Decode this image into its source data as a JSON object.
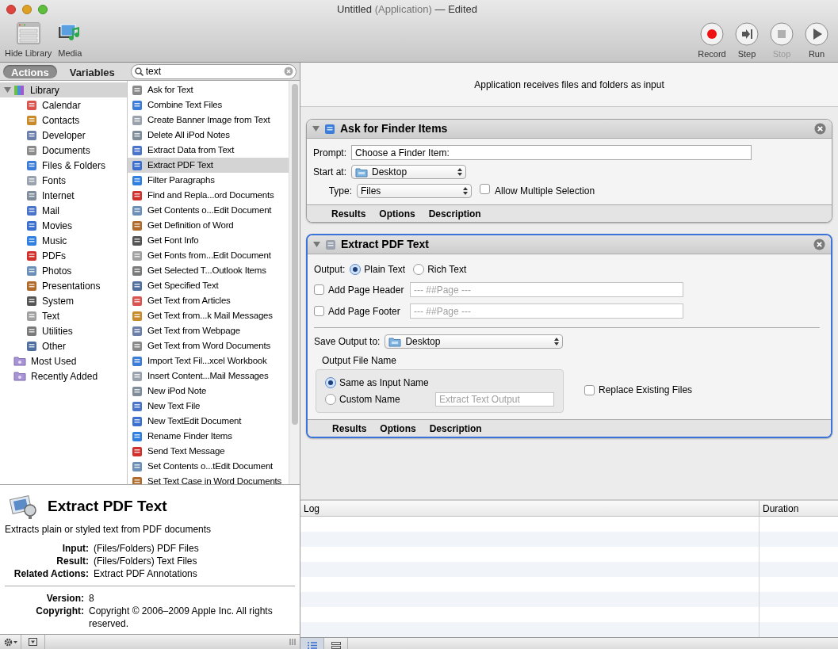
{
  "window": {
    "title": "Untitled",
    "title_kind": "(Application)",
    "title_status": "— Edited"
  },
  "toolbar_left": [
    {
      "kind": "library",
      "label": "Hide Library"
    },
    {
      "kind": "media",
      "label": "Media"
    }
  ],
  "toolbar_right": [
    {
      "kind": "record",
      "label": "Record",
      "disabled": false
    },
    {
      "kind": "step",
      "label": "Step",
      "disabled": false
    },
    {
      "kind": "stop",
      "label": "Stop",
      "disabled": true
    },
    {
      "kind": "run",
      "label": "Run",
      "disabled": false
    }
  ],
  "tabs": [
    {
      "label": "Actions",
      "selected": true
    },
    {
      "label": "Variables",
      "selected": false
    }
  ],
  "search": {
    "value": "text"
  },
  "library": {
    "label": "Library",
    "expanded": true,
    "selected": true,
    "children": [
      {
        "label": "Calendar"
      },
      {
        "label": "Contacts"
      },
      {
        "label": "Developer"
      },
      {
        "label": "Documents"
      },
      {
        "label": "Files & Folders"
      },
      {
        "label": "Fonts"
      },
      {
        "label": "Internet"
      },
      {
        "label": "Mail"
      },
      {
        "label": "Movies"
      },
      {
        "label": "Music"
      },
      {
        "label": "PDFs"
      },
      {
        "label": "Photos"
      },
      {
        "label": "Presentations"
      },
      {
        "label": "System"
      },
      {
        "label": "Text"
      },
      {
        "label": "Utilities"
      },
      {
        "label": "Other"
      }
    ]
  },
  "groups": [
    {
      "label": "Most Used"
    },
    {
      "label": "Recently Added"
    }
  ],
  "actions_list": [
    {
      "label": "Ask for Text",
      "selected": false
    },
    {
      "label": "Combine Text Files",
      "selected": false
    },
    {
      "label": "Create Banner Image from Text",
      "selected": false
    },
    {
      "label": "Delete All iPod Notes",
      "selected": false
    },
    {
      "label": "Extract Data from Text",
      "selected": false
    },
    {
      "label": "Extract PDF Text",
      "selected": true
    },
    {
      "label": "Filter Paragraphs",
      "selected": false
    },
    {
      "label": "Find and Repla...ord Documents",
      "selected": false
    },
    {
      "label": "Get Contents o...Edit Document",
      "selected": false
    },
    {
      "label": "Get Definition of Word",
      "selected": false
    },
    {
      "label": "Get Font Info",
      "selected": false
    },
    {
      "label": "Get Fonts from...Edit Document",
      "selected": false
    },
    {
      "label": "Get Selected T...Outlook Items",
      "selected": false
    },
    {
      "label": "Get Specified Text",
      "selected": false
    },
    {
      "label": "Get Text from Articles",
      "selected": false
    },
    {
      "label": "Get Text from...k Mail Messages",
      "selected": false
    },
    {
      "label": "Get Text from Webpage",
      "selected": false
    },
    {
      "label": "Get Text from Word Documents",
      "selected": false
    },
    {
      "label": "Import Text Fil...xcel Workbook",
      "selected": false
    },
    {
      "label": "Insert Content...Mail Messages",
      "selected": false
    },
    {
      "label": "New iPod Note",
      "selected": false
    },
    {
      "label": "New Text File",
      "selected": false
    },
    {
      "label": "New TextEdit Document",
      "selected": false
    },
    {
      "label": "Rename Finder Items",
      "selected": false
    },
    {
      "label": "Send Text Message",
      "selected": false
    },
    {
      "label": "Set Contents o...tEdit Document",
      "selected": false
    },
    {
      "label": "Set Text Case in Word Documents",
      "selected": false
    }
  ],
  "description": {
    "title": "Extract PDF Text",
    "summary": "Extracts plain or styled text from PDF documents",
    "fields": [
      {
        "label": "Input:",
        "value": "(Files/Folders) PDF Files"
      },
      {
        "label": "Result:",
        "value": "(Files/Folders) Text Files"
      },
      {
        "label": "Related Actions:",
        "value": "Extract PDF Annotations"
      }
    ],
    "fields2": [
      {
        "label": "Version:",
        "value": "8"
      },
      {
        "label": "Copyright:",
        "value": "Copyright © 2006–2009 Apple Inc. All rights reserved."
      }
    ]
  },
  "workflow": {
    "header": "Application receives files and folders as input",
    "actions": [
      {
        "kind": "finder_items",
        "title": "Ask for Finder Items",
        "expanded": true,
        "selected": false,
        "prompt_label": "Prompt:",
        "prompt_value": "Choose a Finder Item:",
        "start_label": "Start at:",
        "start_value": "Desktop",
        "type_label": "Type:",
        "type_value": "Files",
        "multiple": {
          "label": "Allow Multiple Selection",
          "checked": false
        },
        "footer": [
          "Results",
          "Options",
          "Description"
        ]
      },
      {
        "kind": "extract_pdf",
        "title": "Extract PDF Text",
        "expanded": true,
        "selected": true,
        "output_label": "Output:",
        "output_options": [
          {
            "label": "Plain Text",
            "selected": true
          },
          {
            "label": "Rich Text",
            "selected": false
          }
        ],
        "page_header": {
          "label": "Add Page Header",
          "checked": false,
          "placeholder": "--- ##Page ---"
        },
        "page_footer": {
          "label": "Add Page Footer",
          "checked": false,
          "placeholder": "--- ##Page ---"
        },
        "save_label": "Save Output to:",
        "save_value": "Desktop",
        "file_name_title": "Output File Name",
        "name_options": [
          {
            "label": "Same as Input Name",
            "selected": true
          },
          {
            "label": "Custom Name",
            "selected": false
          }
        ],
        "custom_placeholder": "Extract Text Output",
        "replace": {
          "label": "Replace Existing Files",
          "checked": false
        },
        "footer": [
          "Results",
          "Options",
          "Description"
        ]
      }
    ]
  },
  "log": {
    "columns": [
      "Log",
      "Duration"
    ]
  }
}
